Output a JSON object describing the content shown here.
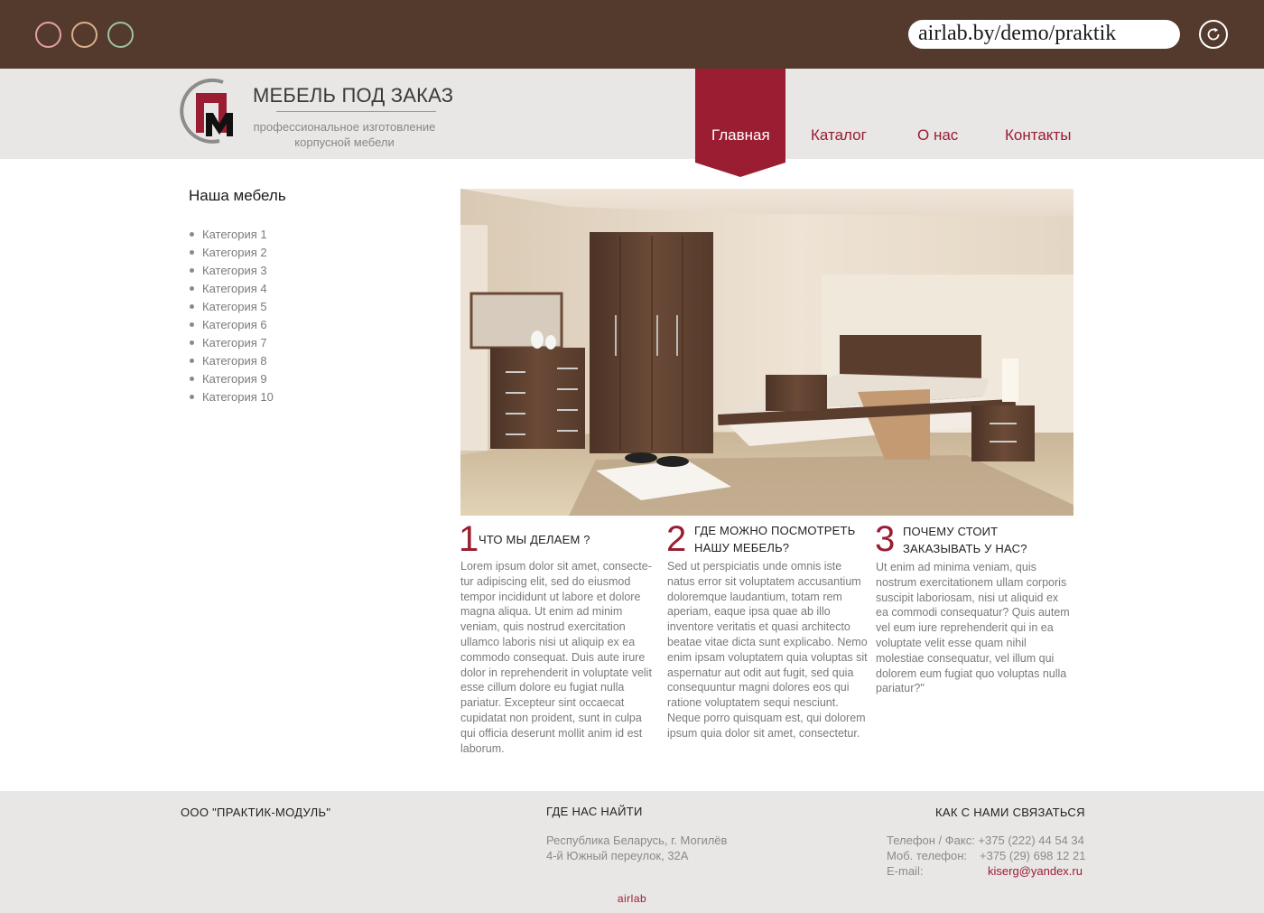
{
  "browser": {
    "url": "airlab.by/demo/praktik",
    "window_buttons": [
      "close-dot",
      "minimize-dot",
      "maximize-dot"
    ],
    "icons": {
      "reload": "reload-icon"
    }
  },
  "brand": {
    "logo_letters": "ПМ",
    "title": "МЕБЕЛЬ ПОД ЗАКАЗ",
    "subtitle_line1": "профессиональное изготовление",
    "subtitle_line2": "корпусной мебели",
    "accent_color": "#9b1d32",
    "chrome_color": "#533a2d"
  },
  "nav": {
    "items": [
      {
        "label": "Главная",
        "active": true
      },
      {
        "label": "Каталог",
        "active": false
      },
      {
        "label": "О нас",
        "active": false
      },
      {
        "label": "Контакты",
        "active": false
      }
    ]
  },
  "sidebar": {
    "title": "Наша мебель",
    "items": [
      "Категория 1",
      "Категория 2",
      "Категория 3",
      "Категория 4",
      "Категория 5",
      "Категория 6",
      "Категория 7",
      "Категория 8",
      "Категория 9",
      "Категория 10"
    ]
  },
  "features": [
    {
      "number": "1",
      "title_line1": "ЧТО МЫ ДЕЛАЕМ ?",
      "title_line2": "",
      "body": "Lorem ipsum dolor sit amet, consecte-tur adipiscing elit, sed do eiusmod tempor incididunt ut labore et dolore magna aliqua. Ut enim ad minim veniam, quis nostrud exercitation ullamco laboris nisi ut aliquip ex ea commodo consequat. Duis aute irure dolor in reprehenderit in voluptate velit esse cillum dolore eu fugiat nulla pariatur. Excepteur sint occaecat cupidatat non proident, sunt in culpa qui officia deserunt mollit anim id est laborum."
    },
    {
      "number": "2",
      "title_line1": "ГДЕ МОЖНО ПОСМОТРЕТЬ",
      "title_line2": "НАШУ МЕБЕЛЬ?",
      "body": "Sed ut perspiciatis unde omnis iste natus error sit voluptatem accusantium doloremque laudantium, totam rem aperiam, eaque ipsa quae ab illo inventore veritatis et quasi architecto beatae vitae dicta sunt explicabo. Nemo enim ipsam voluptatem quia voluptas sit aspernatur aut odit aut fugit, sed quia consequuntur magni dolores eos qui ratione voluptatem sequi nesciunt. Neque porro quisquam est, qui dolorem ipsum quia dolor sit amet, consectetur."
    },
    {
      "number": "3",
      "title_line1": "ПОЧЕМУ СТОИТ",
      "title_line2": "ЗАКАЗЫВАТЬ У НАС?",
      "body": "Ut enim ad minima veniam, quis nostrum exercitationem ullam corporis suscipit laboriosam, nisi ut aliquid ex ea commodi consequatur? Quis autem vel eum iure reprehenderit qui in ea voluptate velit esse quam nihil molestiae consequatur, vel illum qui dolorem eum fugiat quo voluptas nulla pariatur?\""
    }
  ],
  "footer": {
    "company": "ООО \"ПРАКТИК-МОДУЛЬ\"",
    "where_title": "ГДЕ НАС НАЙТИ",
    "address_line1": "Республика Беларусь, г. Могилёв",
    "address_line2": "4-й Южный переулок, 32А",
    "contact_title": "КАК С НАМИ СВЯЗАТЬСЯ",
    "phone_fax": "Телефон / Факс: +375 (222) 44 54 34",
    "mobile_label": "Моб. телефон:",
    "mobile_value": "+375 (29) 698 12 21",
    "email_label": "E-mail:",
    "email_value": "kiserg@yandex.ru",
    "credit": "airlab"
  }
}
